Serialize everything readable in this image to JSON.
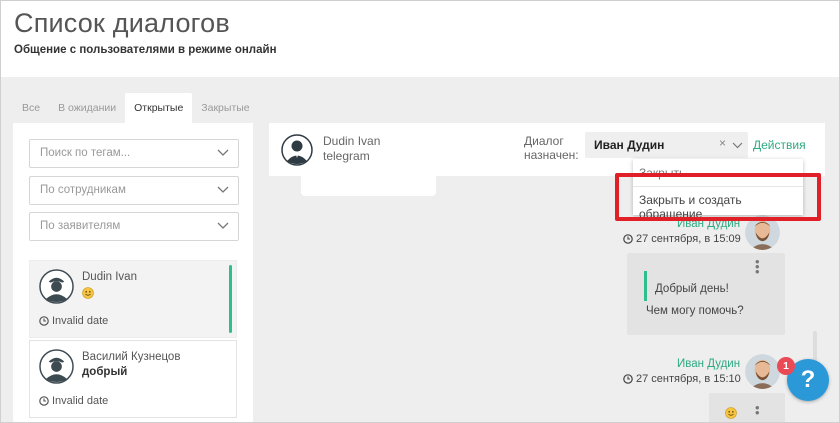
{
  "header": {
    "title": "Список диалогов",
    "subtitle": "Общение с пользователями в режиме онлайн"
  },
  "tabs": [
    {
      "label": "Все",
      "active": false
    },
    {
      "label": "В ожидании",
      "active": false
    },
    {
      "label": "Открытые",
      "active": true
    },
    {
      "label": "Закрытые",
      "active": false
    }
  ],
  "filters": {
    "tags_placeholder": "Поиск по тегам...",
    "employees_placeholder": "По сотрудникам",
    "applicants_placeholder": "По заявителям"
  },
  "dialogs": [
    {
      "name": "Dudin Ivan",
      "message_icon": "smile-emoji-icon",
      "date": "Invalid date",
      "selected": true
    },
    {
      "name": "Василий Кузнецов",
      "message": "добрый",
      "date": "Invalid date",
      "selected": false
    }
  ],
  "chat": {
    "user_name": "Dudin Ivan",
    "channel": "telegram",
    "assigned_label": "Диалог назначен:",
    "assigned_value": "Иван Дудин",
    "clear_symbol": "×",
    "actions_label": "Действия",
    "dropdown": {
      "item_close": "Закрыть",
      "item_close_create": "Закрыть и создать обращение"
    },
    "messages": [
      {
        "author": "Иван Дудин",
        "time": "27 сентября, в 15:09",
        "line1": "Добрый день!",
        "line2": "Чем могу помочь?"
      },
      {
        "author": "Иван Дудин",
        "time": "27 сентября, в 15:10"
      }
    ]
  },
  "widget": {
    "badge_count": "1",
    "help_symbol": "?"
  },
  "colors": {
    "accent_green": "#2fbf8f",
    "link_green": "#2eaa82",
    "highlight_red": "#e01f27",
    "help_blue": "#2b98d8",
    "badge_red": "#ea4a56"
  }
}
